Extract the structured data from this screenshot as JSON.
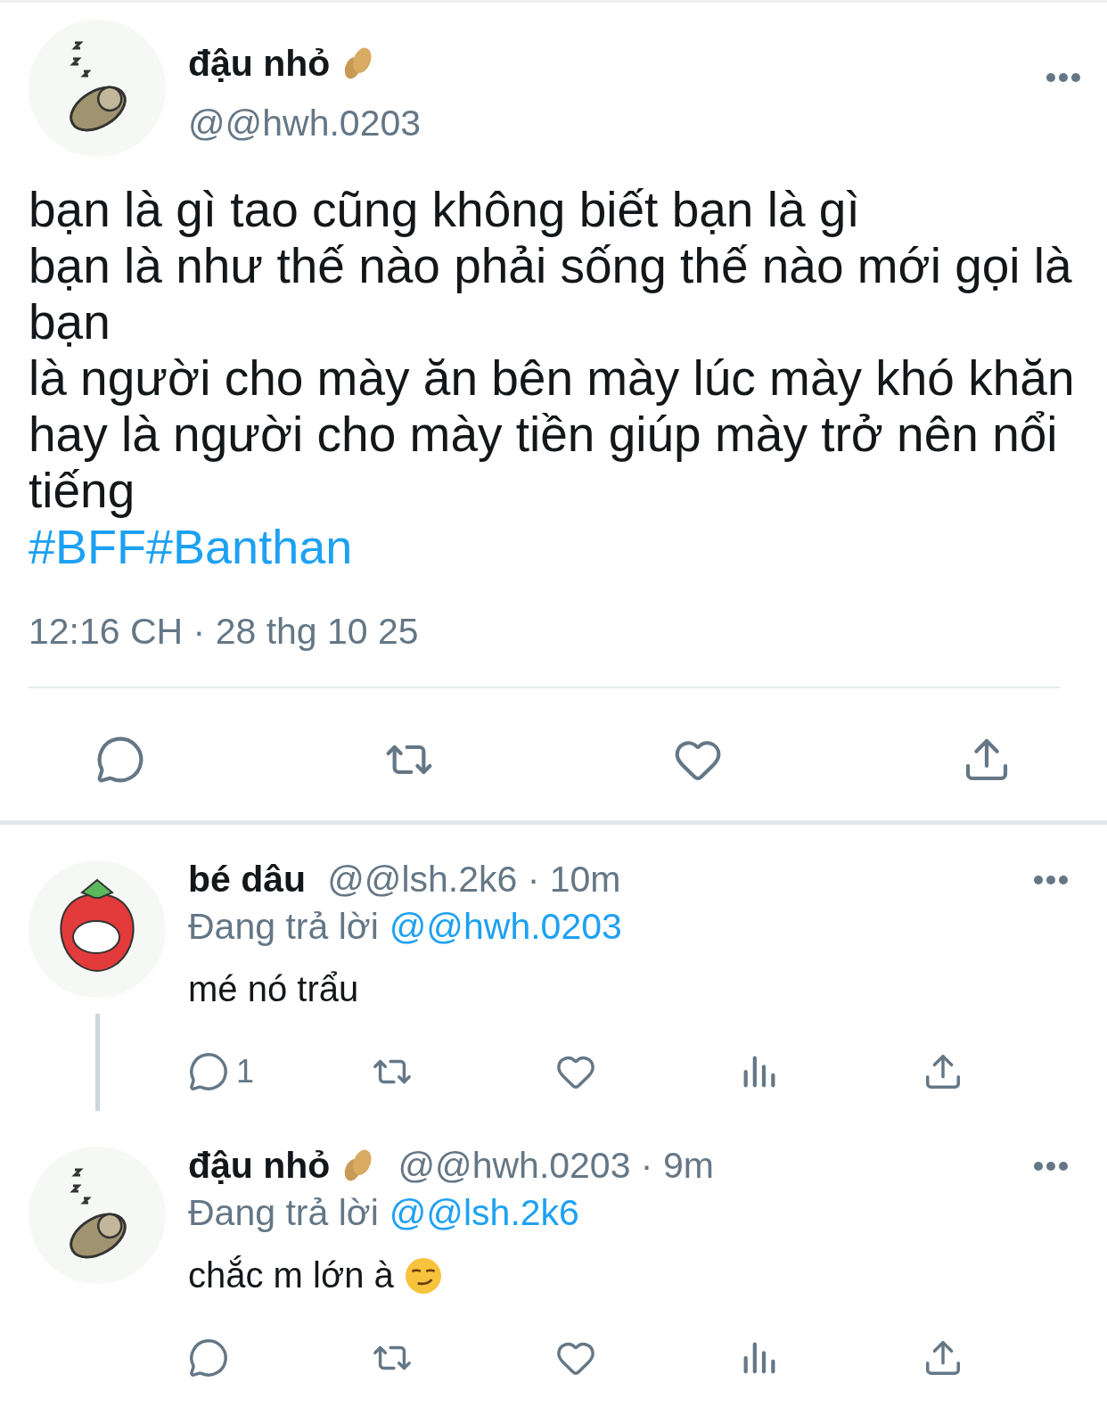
{
  "tweet": {
    "author": {
      "name": "đậu nhỏ",
      "name_emoji": {
        "kind": "peanut"
      },
      "handle": "@@hwh.0203",
      "avatar": {
        "kind": "peanut"
      }
    },
    "text_lines": [
      "bạn là gì tao cũng không biết bạn là gì",
      "bạn là như thế nào phải sống thế nào mới gọi là",
      "bạn",
      "là người cho mày ăn bên mày lúc mày khó khăn",
      "hay là người cho mày tiền giúp mày trở nên nổi",
      "tiếng"
    ],
    "hashtags": "#BFF#Banthan",
    "timestamp": "12:16 CH · 28 thg 10 25",
    "actions": [
      {
        "kind": "reply"
      },
      {
        "kind": "retweet"
      },
      {
        "kind": "like"
      },
      {
        "kind": "share"
      }
    ]
  },
  "replies": [
    {
      "name": "bé dâu",
      "avatar": {
        "kind": "strawberry"
      },
      "meta": "@@lsh.2k6 · 10m",
      "replying_label": "Đang trả lời",
      "replying_to": "@@hwh.0203",
      "text": "mé nó trẩu",
      "thread_line": true,
      "actions": [
        {
          "kind": "reply",
          "count": "1"
        },
        {
          "kind": "retweet"
        },
        {
          "kind": "like"
        },
        {
          "kind": "views"
        },
        {
          "kind": "share"
        }
      ]
    },
    {
      "name": "đậu nhỏ",
      "name_emoji": {
        "kind": "peanut"
      },
      "avatar": {
        "kind": "peanut"
      },
      "meta": "@@hwh.0203 · 9m",
      "replying_label": "Đang trả lời",
      "replying_to": "@@lsh.2k6",
      "text": "chắc m lớn à",
      "trailing_emoji": {
        "kind": "smirk"
      },
      "thread_line": false,
      "actions": [
        {
          "kind": "reply"
        },
        {
          "kind": "retweet"
        },
        {
          "kind": "like"
        },
        {
          "kind": "views"
        },
        {
          "kind": "share"
        }
      ]
    }
  ]
}
